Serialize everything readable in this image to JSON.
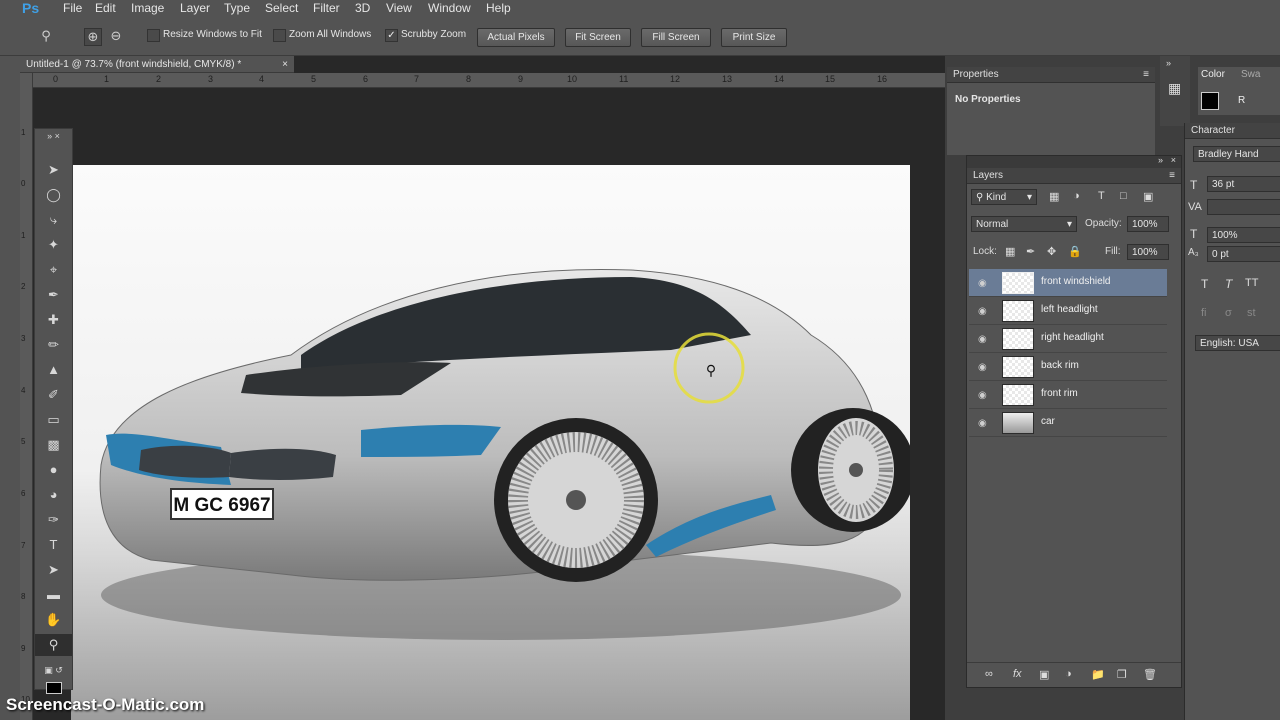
{
  "app": {
    "logo": "Ps"
  },
  "menu": [
    "File",
    "Edit",
    "Image",
    "Layer",
    "Type",
    "Select",
    "Filter",
    "3D",
    "View",
    "Window",
    "Help"
  ],
  "options": {
    "resize_windows": "Resize Windows to Fit",
    "zoom_all": "Zoom All Windows",
    "scrubby_zoom": "Scrubby Zoom",
    "actual_pixels": "Actual Pixels",
    "fit_screen": "Fit Screen",
    "fill_screen": "Fill Screen",
    "print_size": "Print Size"
  },
  "document": {
    "tab_title": "Untitled-1 @ 73.7% (front windshield, CMYK/8) *",
    "ruler_ticks": [
      "0",
      "1",
      "2",
      "3",
      "4",
      "5",
      "6",
      "7",
      "8",
      "9",
      "10",
      "11",
      "12",
      "13",
      "14",
      "15",
      "16"
    ],
    "vruler_ticks": [
      "1",
      "0",
      "1",
      "2",
      "3",
      "4",
      "5",
      "6",
      "7",
      "8",
      "9",
      "10"
    ],
    "plate": "M GC 6967"
  },
  "properties": {
    "title": "Properties",
    "text": "No Properties"
  },
  "layers": {
    "title": "Layers",
    "filter_kind": "Kind",
    "blend_mode": "Normal",
    "opacity_label": "Opacity:",
    "opacity_value": "100%",
    "lock_label": "Lock:",
    "fill_label": "Fill:",
    "fill_value": "100%",
    "items": [
      {
        "name": "front windshield",
        "selected": true
      },
      {
        "name": "left headlight",
        "selected": false
      },
      {
        "name": "right headlight",
        "selected": false
      },
      {
        "name": "back rim",
        "selected": false
      },
      {
        "name": "front rim",
        "selected": false
      },
      {
        "name": "car",
        "selected": false
      }
    ]
  },
  "color_panel": {
    "tab1": "Color",
    "tab2": "Swa",
    "channel": "R"
  },
  "character": {
    "title": "Character",
    "font": "Bradley Hand",
    "size": "36 pt",
    "scale": "100%",
    "baseline": "0 pt",
    "language": "English: USA"
  },
  "watermark": "Screencast-O-Matic.com",
  "colors": {
    "accent": "#3fa0e6",
    "selected_layer": "#6a7c96"
  }
}
